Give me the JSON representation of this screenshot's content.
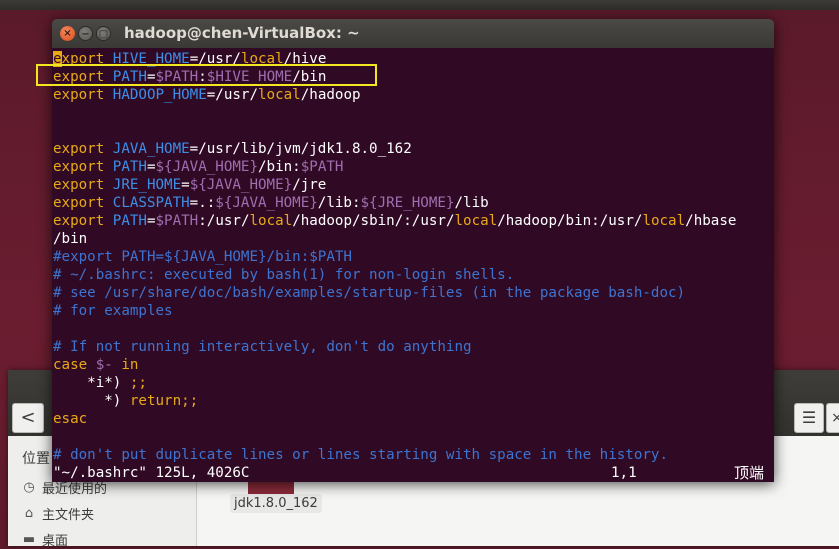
{
  "window": {
    "title": "hadoop@chen-VirtualBox: ~",
    "close_glyph": "×",
    "min_glyph": "−",
    "max_glyph": "□"
  },
  "file_manager": {
    "back_glyph": "<",
    "menu_glyph": "☰",
    "sidebar_title": "位置",
    "sidebar_items": [
      {
        "label": "最近使用的",
        "icon": "clock-icon"
      },
      {
        "label": "主文件夹",
        "icon": "home-icon"
      },
      {
        "label": "桌面",
        "icon": "folder-icon"
      }
    ],
    "file_label": "jdk1.8.0_162"
  },
  "editor": {
    "cursor_char": "e",
    "lines": {
      "l1": {
        "a": "xport",
        "b": " ",
        "c": "HIVE_HOME",
        "d": "=/usr/",
        "e": "local",
        "f": "/hive"
      },
      "l2": {
        "a": "export",
        "b": " ",
        "c": "PATH",
        "d": "=",
        "e": "$PATH",
        "f": ":",
        "g": "$HIVE_HOME",
        "h": "/bin"
      },
      "l3": {
        "a": "export",
        "b": " ",
        "c": "HADOOP_HOME",
        "d": "=/usr/",
        "e": "local",
        "f": "/hadoop"
      },
      "l6": {
        "a": "export",
        "b": " ",
        "c": "JAVA_HOME",
        "d": "=/usr/lib/jvm/jdk1.8.0_162"
      },
      "l7": {
        "a": "export",
        "b": " ",
        "c": "PATH",
        "d": "=",
        "e": "${JAVA_HOME}",
        "f": "/bin:",
        "g": "$PATH"
      },
      "l8": {
        "a": "export",
        "b": " ",
        "c": "JRE_HOME",
        "d": "=",
        "e": "${JAVA_HOME}",
        "f": "/jre"
      },
      "l9": {
        "a": "export",
        "b": " ",
        "c": "CLASSPATH",
        "d": "=.:",
        "e": "${JAVA_HOME}",
        "f": "/lib:",
        "g": "${JRE_HOME}",
        "h": "/lib"
      },
      "l10": {
        "a": "export",
        "b": " ",
        "c": "PATH",
        "d": "=",
        "e": "$PATH",
        "f": ":/usr/",
        "g": "local",
        "h": "/hadoop/sbin/:/usr/",
        "i": "local",
        "j": "/hadoop/bin:/usr/",
        "k": "local",
        "l": "/hbase"
      },
      "l11": "/bin",
      "l12": "#export PATH=${JAVA_HOME}/bin:$PATH",
      "l13": "# ~/.bashrc: executed by bash(1) for non-login shells.",
      "l14": "# see /usr/share/doc/bash/examples/startup-files (in the package bash-doc)",
      "l15": "# for examples",
      "l17": "# If not running interactively, don't do anything",
      "l18": {
        "a": "case",
        "b": " ",
        "c": "$-",
        "d": " ",
        "e": "in"
      },
      "l19": {
        "a": "    *i*) ",
        "b": ";;"
      },
      "l20": {
        "a": "      *) ",
        "b": "return",
        "c": ";;"
      },
      "l21": "esac",
      "l23": "# don't put duplicate lines or lines starting with space in the history."
    },
    "status": {
      "file_info": "\"~/.bashrc\" 125L, 4026C",
      "position": "1,1",
      "scroll": "顶端"
    }
  },
  "colors": {
    "terminal_bg": "#300a24",
    "keyword": "#e9a917",
    "variable": "#3d8ee8",
    "reference": "#a06eb0",
    "comment": "#3d74d1",
    "highlight_box": "#f2e620"
  }
}
